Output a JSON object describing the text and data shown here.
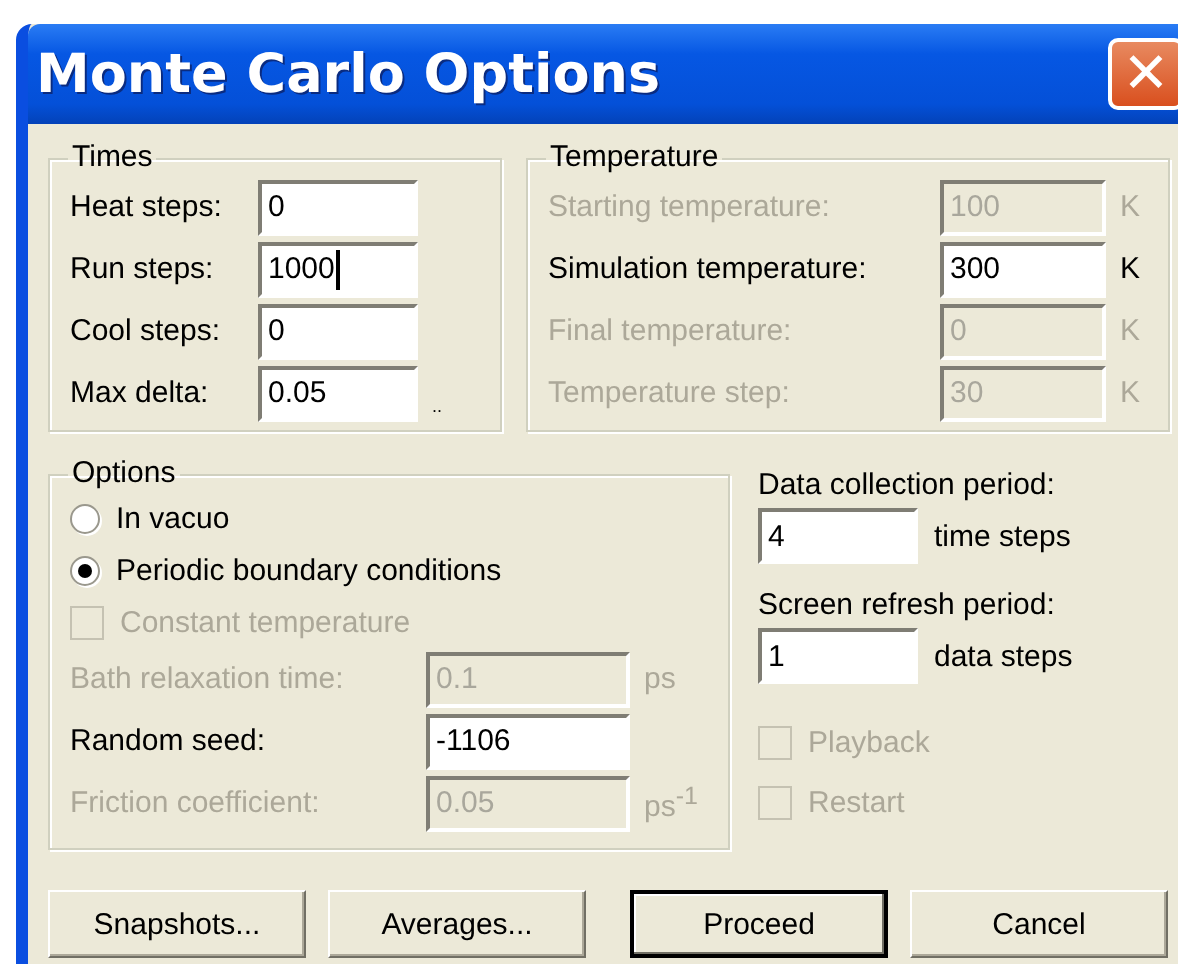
{
  "window": {
    "title": "Monte Carlo Options",
    "close": "✕"
  },
  "times": {
    "title": "Times",
    "fields": [
      {
        "label": "Heat steps:",
        "value": "0",
        "disabled": false,
        "focused": false
      },
      {
        "label": "Run steps:",
        "value": "1000",
        "disabled": false,
        "focused": true
      },
      {
        "label": "Cool steps:",
        "value": "0",
        "disabled": false,
        "focused": false
      },
      {
        "label": "Max delta:",
        "value": "0.05",
        "unit": "..",
        "disabled": false,
        "focused": false
      }
    ]
  },
  "temperature": {
    "title": "Temperature",
    "fields": [
      {
        "label": "Starting temperature:",
        "value": "100",
        "unit": "K",
        "disabled": true
      },
      {
        "label": "Simulation temperature:",
        "value": "300",
        "unit": "K",
        "disabled": false
      },
      {
        "label": "Final temperature:",
        "value": "0",
        "unit": "K",
        "disabled": true
      },
      {
        "label": "Temperature step:",
        "value": "30",
        "unit": "K",
        "disabled": true
      }
    ]
  },
  "options": {
    "title": "Options",
    "radios": [
      {
        "label": "In vacuo",
        "selected": false
      },
      {
        "label": "Periodic boundary conditions",
        "selected": true
      }
    ],
    "checkbox": {
      "label": "Constant temperature",
      "checked": false,
      "disabled": true
    },
    "fields": [
      {
        "label": "Bath relaxation time:",
        "value": "0.1",
        "unit": "ps",
        "disabled": true
      },
      {
        "label": "Random seed:",
        "value": "-1106",
        "disabled": false
      },
      {
        "label": "Friction coefficient:",
        "value": "0.05",
        "unit": "ps$^{-1}$",
        "disabled": true
      }
    ]
  },
  "periods": [
    {
      "label": "Data collection period:",
      "value": "4",
      "unit": "time steps"
    },
    {
      "label": "Screen refresh period:",
      "value": "1",
      "unit": "data steps"
    }
  ],
  "checkboxes": [
    {
      "label": "Playback",
      "checked": false,
      "disabled": true
    },
    {
      "label": "Restart",
      "checked": false,
      "disabled": true
    }
  ],
  "buttons": [
    {
      "label": "Snapshots...",
      "default": false
    },
    {
      "label": "Averages...",
      "default": false
    },
    {
      "label": "Proceed",
      "default": true
    },
    {
      "label": "Cancel",
      "default": false
    }
  ]
}
